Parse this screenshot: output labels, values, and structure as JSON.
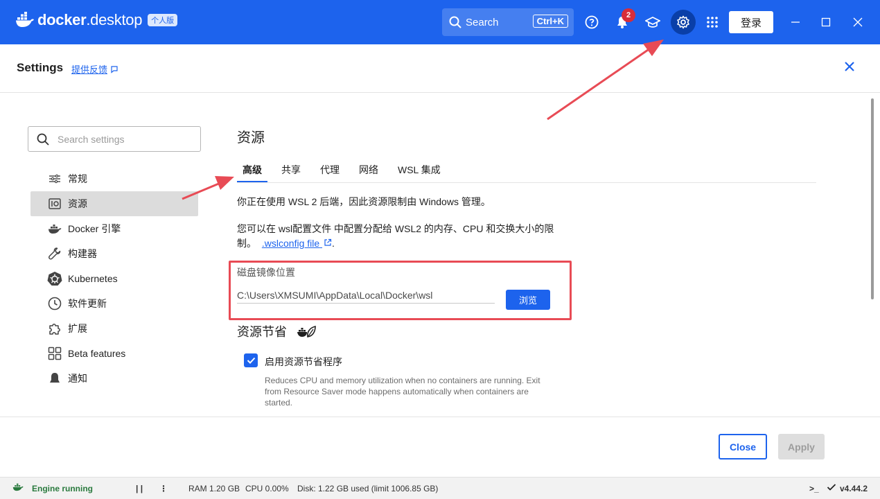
{
  "titlebar": {
    "brand_bold": "docker",
    "brand_light": ".desktop",
    "edition": "个人版",
    "search_label": "Search",
    "search_shortcut": "Ctrl+K",
    "notification_count": "2",
    "login_label": "登录"
  },
  "header": {
    "title": "Settings",
    "feedback": "提供反馈"
  },
  "sidebar": {
    "search_placeholder": "Search settings",
    "items": [
      {
        "label": "常规",
        "icon": "sliders-icon"
      },
      {
        "label": "资源",
        "icon": "resources-icon",
        "active": true
      },
      {
        "label": "Docker 引擎",
        "icon": "whale-icon"
      },
      {
        "label": "构建器",
        "icon": "wrench-icon"
      },
      {
        "label": "Kubernetes",
        "icon": "kubernetes-icon"
      },
      {
        "label": "软件更新",
        "icon": "clock-icon"
      },
      {
        "label": "扩展",
        "icon": "puzzle-icon"
      },
      {
        "label": "Beta features",
        "icon": "grid-icon"
      },
      {
        "label": "通知",
        "icon": "bell-icon"
      }
    ]
  },
  "main": {
    "title": "资源",
    "tabs": [
      {
        "label": "高级",
        "active": true
      },
      {
        "label": "共享"
      },
      {
        "label": "代理"
      },
      {
        "label": "网络"
      },
      {
        "label": "WSL 集成"
      }
    ],
    "wsl_notice": "你正在使用 WSL 2 后端，因此资源限制由 Windows 管理。",
    "wsl_config_text": "您可以在 wsl配置文件 中配置分配给 WSL2 的内存、CPU 和交换大小的限制。",
    "wsl_config_link": ".wslconfig file",
    "wsl_config_tail": ".",
    "disk_label": "磁盘镜像位置",
    "disk_path": "C:\\Users\\XMSUMI\\AppData\\Local\\Docker\\wsl",
    "browse_label": "浏览",
    "saver_title": "资源节省",
    "saver_checkbox_label": "启用资源节省程序",
    "saver_checked": true,
    "saver_desc": "Reduces CPU and memory utilization when no containers are running. Exit from Resource Saver mode happens automatically when containers are started."
  },
  "footer": {
    "close_label": "Close",
    "apply_label": "Apply"
  },
  "statusbar": {
    "engine": "Engine running",
    "pause": "| |",
    "more": "⋮",
    "ram": "RAM 1.20 GB",
    "cpu": "CPU 0.00%",
    "disk": "Disk: 1.22 GB used (limit 1006.85 GB)",
    "terminal": ">_",
    "version": "v4.44.2"
  },
  "colors": {
    "brand": "#1d63ed",
    "annotation_red": "#e84b55",
    "engine_green": "#2a7a3e"
  }
}
